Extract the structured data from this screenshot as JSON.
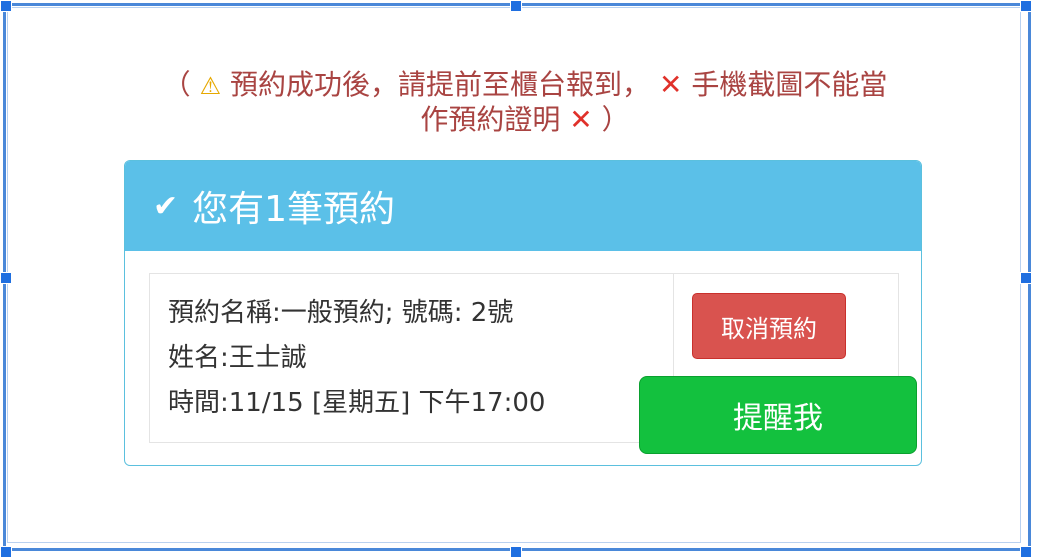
{
  "notice": {
    "open_paren": "（",
    "warning_icon": "warning-icon",
    "warning_glyph": "⚠",
    "line1_text": "預約成功後，請提前至櫃台報到，",
    "cross_glyph": "✕",
    "line1_end": "手機截圖不能當",
    "line2_text": "作預約證明",
    "close_paren": "）",
    "text_color": "#a94442",
    "cross_color": "#e0312a"
  },
  "panel": {
    "heading_icon": "check-icon",
    "heading_glyph": "✔",
    "heading_title": "您有1筆預約",
    "heading_bg": "#5bc0e8"
  },
  "booking": {
    "name_line": "預約名稱:一般預約; 號碼: 2號",
    "person_line": "姓名:王士誠",
    "time_line": "時間:11/15 [星期五] 下午17:00"
  },
  "actions": {
    "cancel_label": "取消預約",
    "cancel_color": "#d9534f",
    "remind_label": "提醒我",
    "remind_color": "#13c13e"
  }
}
